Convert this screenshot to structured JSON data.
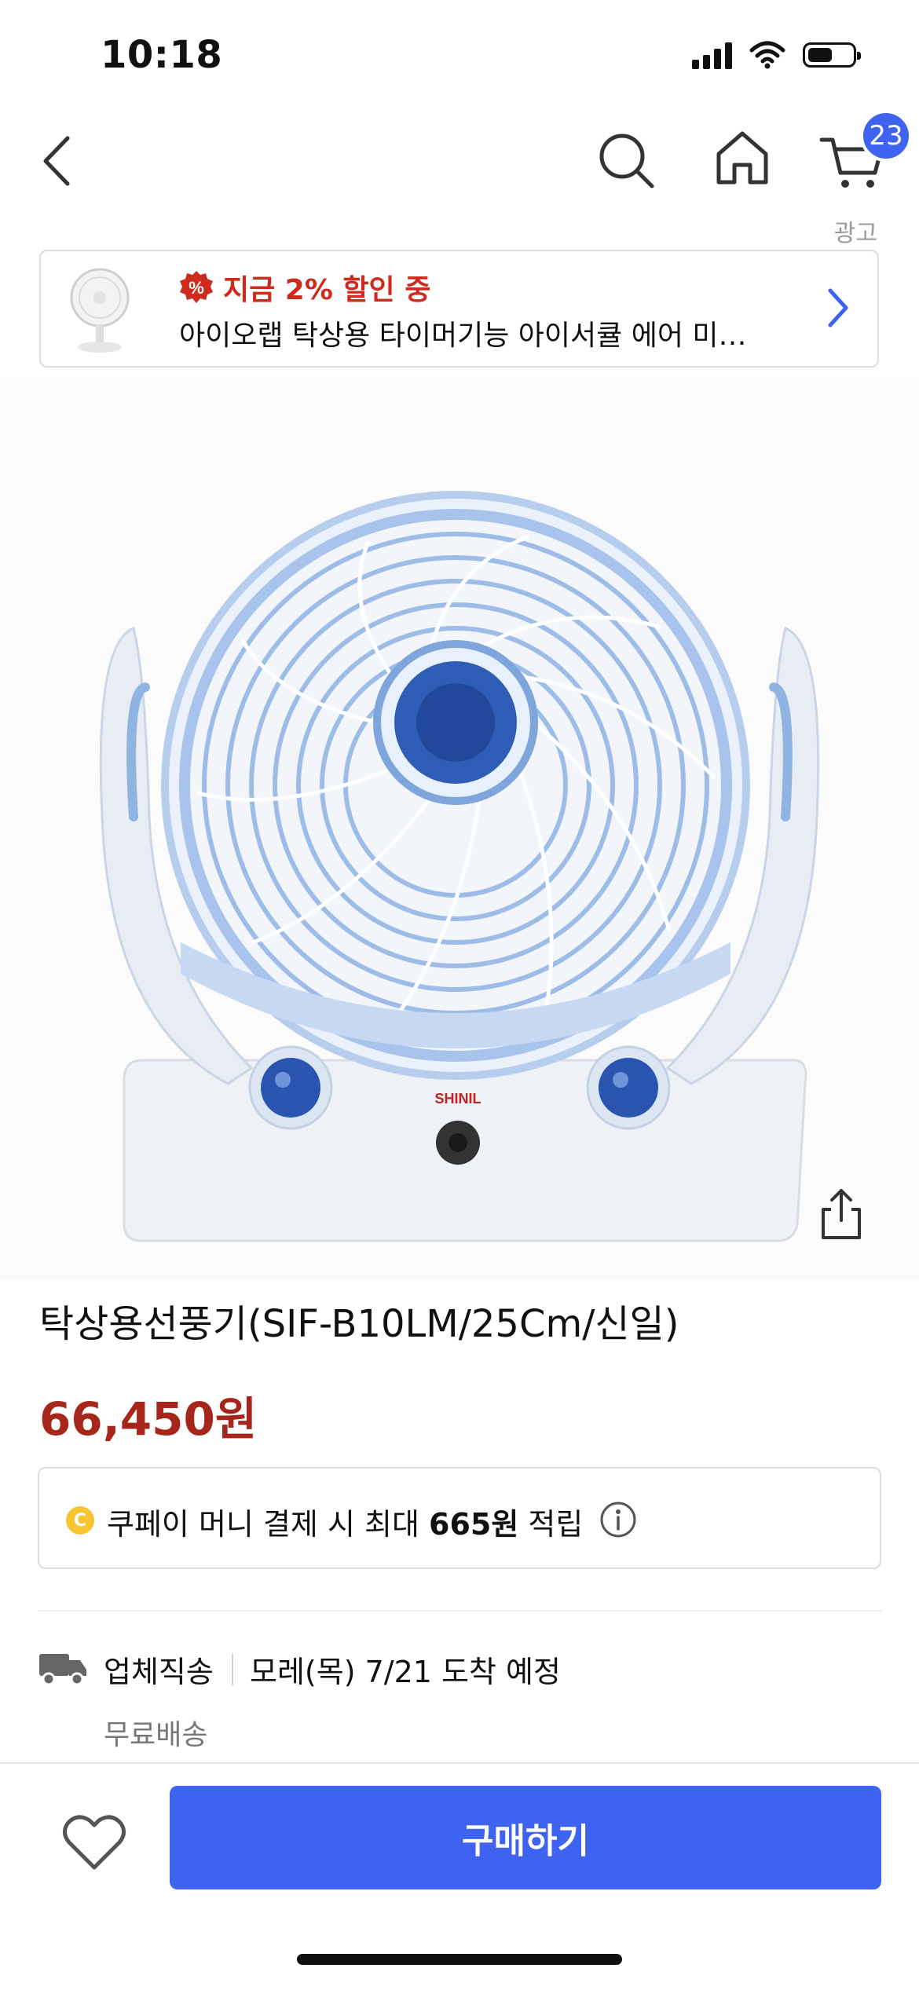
{
  "status_bar": {
    "time": "10:18",
    "battery_level": 0.55
  },
  "nav": {
    "cart_count": "23"
  },
  "ad": {
    "label": "광고",
    "discount_icon": "%",
    "discount_text": "지금 2% 할인 중",
    "title": "아이오랩 탁상용 타이머기능 아이서큘 에어 미…"
  },
  "product": {
    "title": "탁상용선풍기(SIF-B10LM/25Cm/신일)",
    "price": "66,450원",
    "image_brand": "SHINIL"
  },
  "cash": {
    "coin_icon": "C",
    "prefix": "쿠페이 머니 결제 시 최대 ",
    "amount": "665원",
    "suffix": " 적립"
  },
  "shipping": {
    "type": "업체직송",
    "date": "모레(목) 7/21 도착 예정",
    "free": "무료배송"
  },
  "bottom": {
    "buy_label": "구매하기"
  },
  "colors": {
    "accent": "#3e63f0",
    "price": "#a6261c",
    "discount": "#cf2b1c"
  }
}
